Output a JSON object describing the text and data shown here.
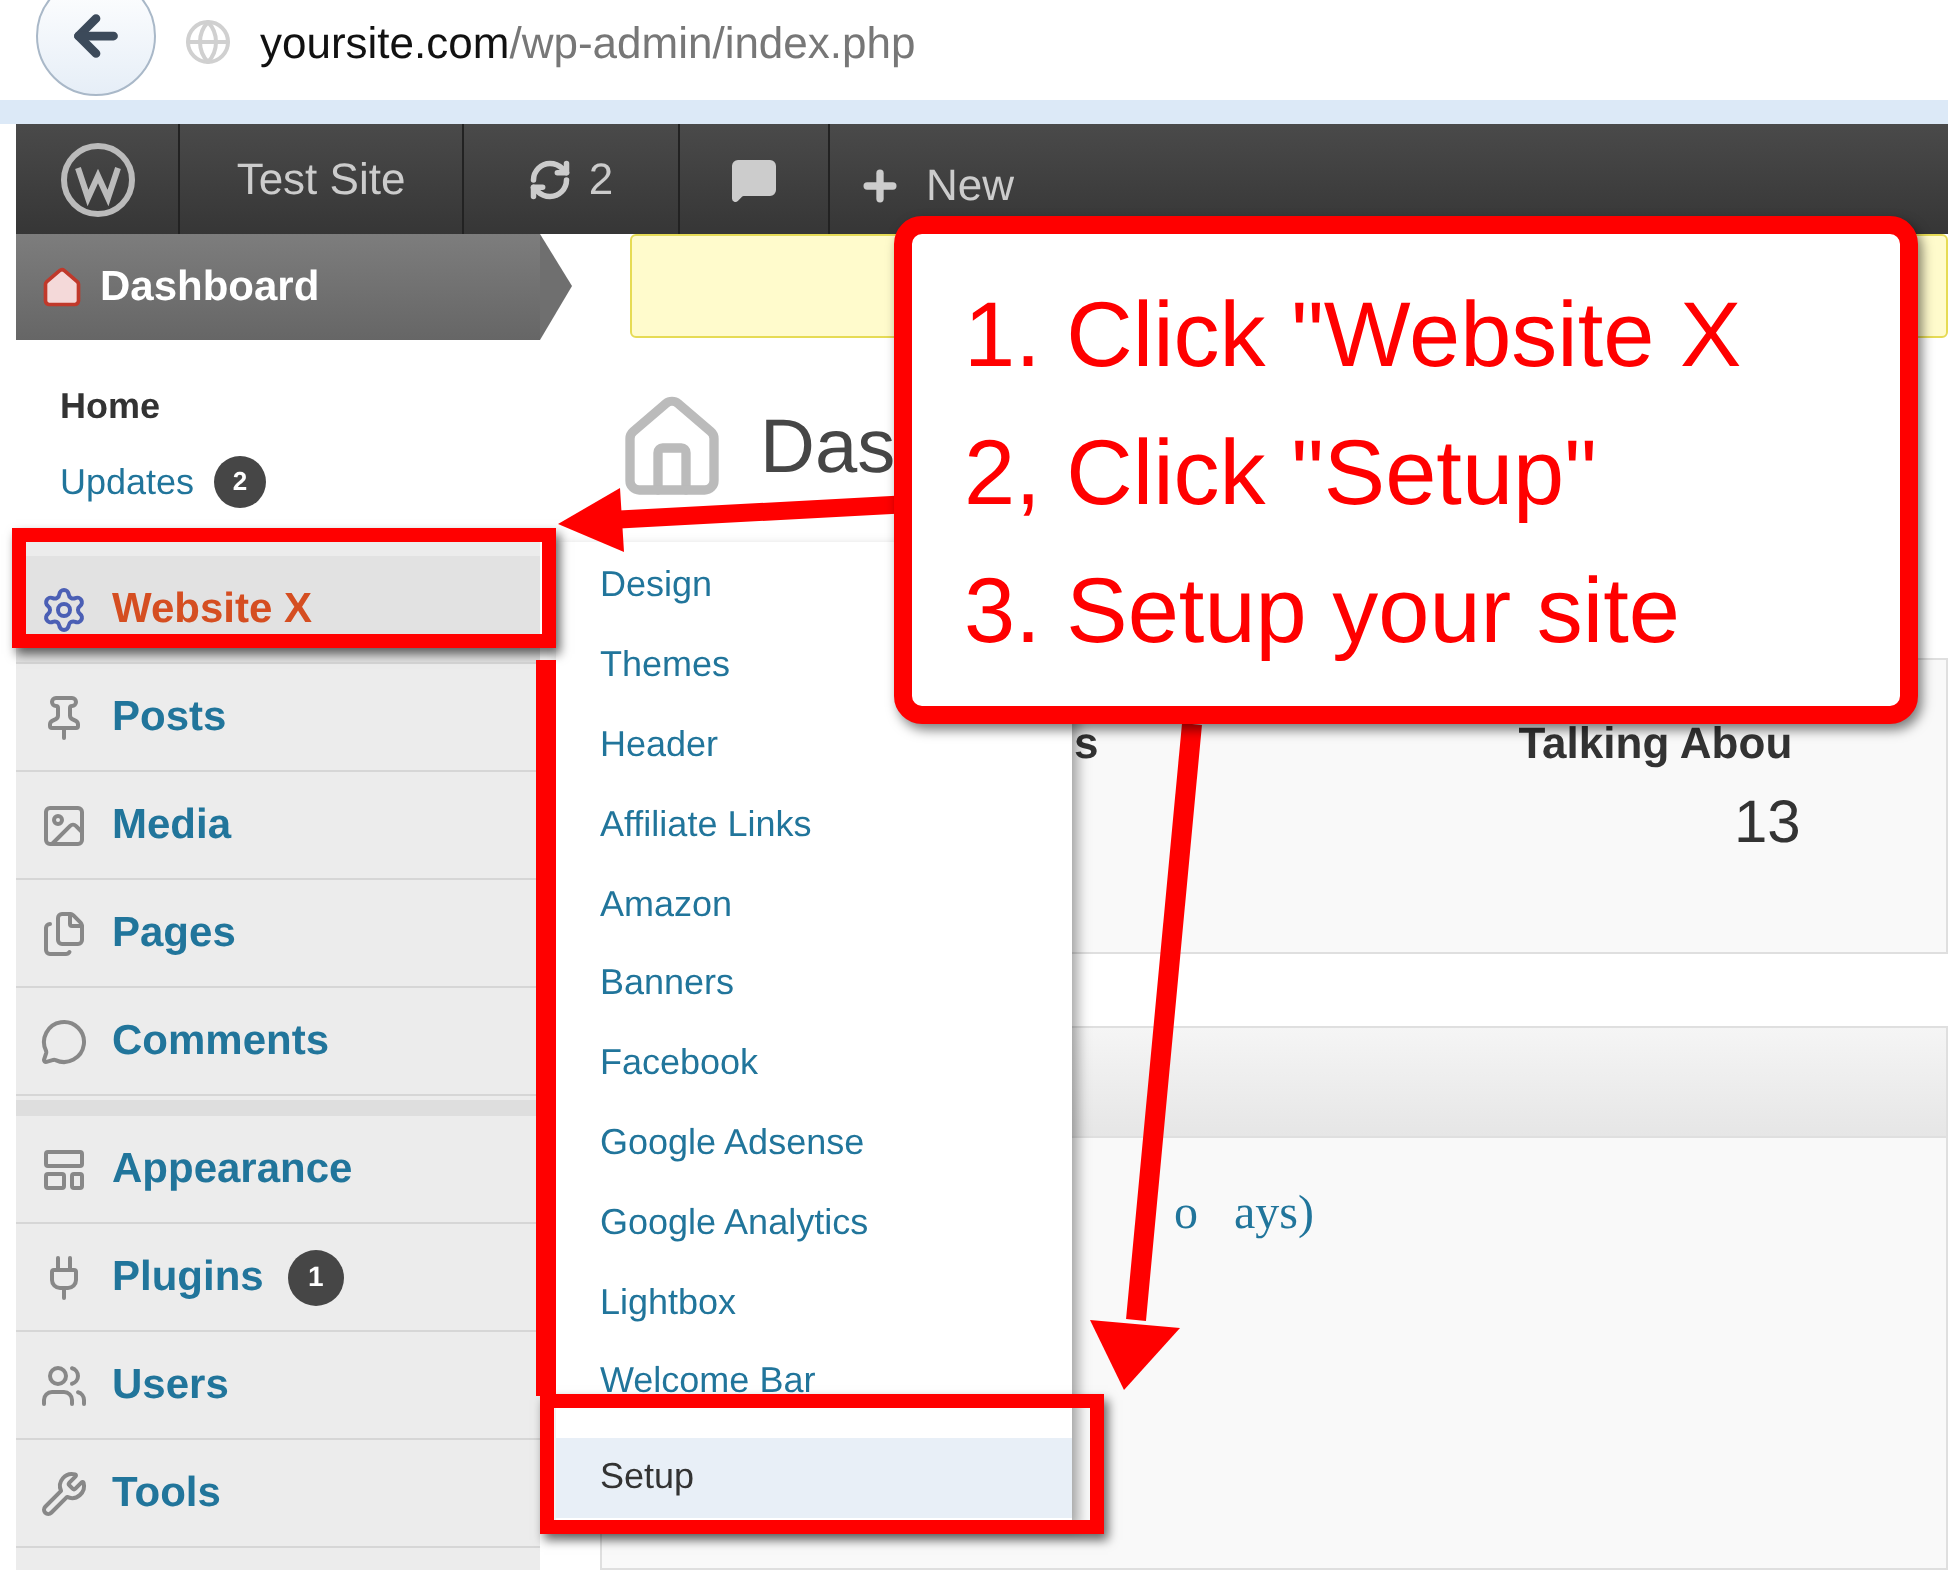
{
  "browser": {
    "url_domain": "yoursite.com",
    "url_path": "/wp-admin/index.php"
  },
  "admin_bar": {
    "site": "Test Site",
    "updates": "2",
    "new": "New"
  },
  "sidebar": {
    "dashboard": {
      "label": "Dashboard",
      "current": true
    },
    "submenu": [
      {
        "label": "Home",
        "selected": true
      },
      {
        "label": "Updates",
        "selected": false,
        "badge": "2"
      }
    ],
    "groups": [
      [
        {
          "label": "Website X",
          "hovered": true
        },
        {
          "label": "Posts",
          "hovered": false
        },
        {
          "label": "Media",
          "hovered": false
        },
        {
          "label": "Pages",
          "hovered": false
        },
        {
          "label": "Comments",
          "hovered": false
        }
      ],
      [
        {
          "label": "Appearance",
          "hovered": false
        },
        {
          "label": "Plugins",
          "hovered": false,
          "badge": "1"
        },
        {
          "label": "Users",
          "hovered": false
        },
        {
          "label": "Tools",
          "hovered": false
        }
      ]
    ]
  },
  "flyout": [
    {
      "label": "Design",
      "selected": false
    },
    {
      "label": "Themes",
      "selected": false
    },
    {
      "label": "Header",
      "selected": false
    },
    {
      "label": "Affiliate Links",
      "selected": false
    },
    {
      "label": "Amazon",
      "selected": false
    },
    {
      "label": "Banners",
      "selected": false
    },
    {
      "label": "Facebook",
      "selected": false
    },
    {
      "label": "Google Adsense",
      "selected": false
    },
    {
      "label": "Google Analytics",
      "selected": false
    },
    {
      "label": "Lightbox",
      "selected": false
    },
    {
      "label": "Welcome Bar",
      "selected": false
    },
    {
      "label": "Setup",
      "selected": true
    }
  ],
  "content": {
    "heading": "Das",
    "panel_1": {
      "column_1": "s",
      "column_2": "Talking Abou",
      "value": "13"
    },
    "panel_2": {
      "text_1": "o",
      "text_2": "ays)"
    }
  },
  "callout": {
    "lines": [
      "1. Click \"Website X",
      "2, Click \"Setup\"",
      "3. Setup your site"
    ]
  }
}
